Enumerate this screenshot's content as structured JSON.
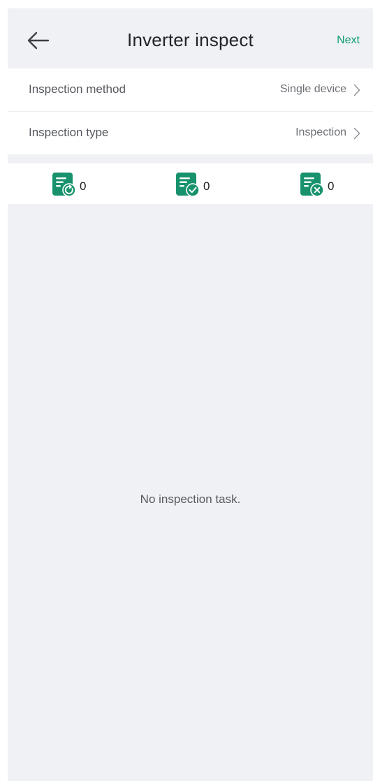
{
  "header": {
    "back_icon": "arrow-left-icon",
    "title": "Inverter inspect",
    "next_label": "Next"
  },
  "settings": [
    {
      "label": "Inspection method",
      "value": "Single device"
    },
    {
      "label": "Inspection type",
      "value": "Inspection"
    }
  ],
  "stats": [
    {
      "icon": "task-pending-icon",
      "count": "0"
    },
    {
      "icon": "task-completed-icon",
      "count": "0"
    },
    {
      "icon": "task-failed-icon",
      "count": "0"
    }
  ],
  "empty_state": {
    "message": "No inspection task."
  },
  "colors": {
    "accent": "#0e9d72",
    "background": "#f0f1f5",
    "icon_green": "#17926c"
  }
}
